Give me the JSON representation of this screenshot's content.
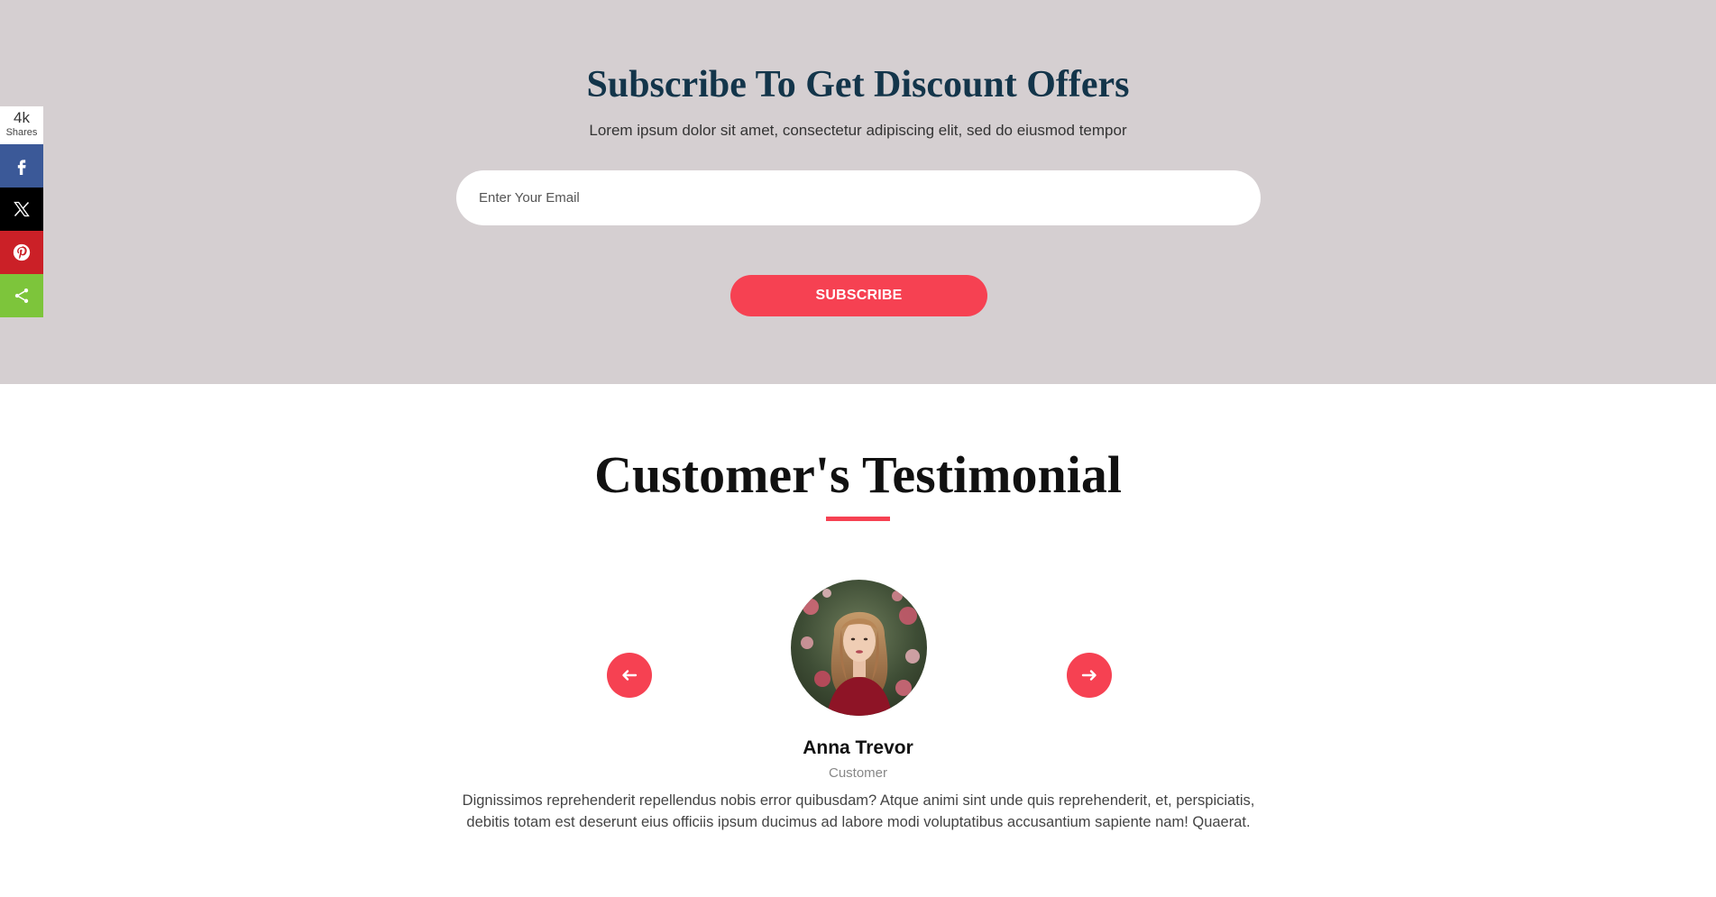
{
  "subscribe": {
    "title": "Subscribe To Get Discount Offers",
    "subtitle": "Lorem ipsum dolor sit amet, consectetur adipiscing elit, sed do eiusmod tempor",
    "email_placeholder": "Enter Your Email",
    "button_label": "SUBSCRIBE",
    "background_color": "#d5cfd1",
    "accent_color": "#f64152"
  },
  "share_bar": {
    "count": "4k",
    "count_label": "Shares",
    "buttons": [
      {
        "network": "facebook",
        "icon": "facebook-icon",
        "color": "#3b5998"
      },
      {
        "network": "x",
        "icon": "x-icon",
        "color": "#000000"
      },
      {
        "network": "pinterest",
        "icon": "pinterest-icon",
        "color": "#cb2027"
      },
      {
        "network": "share",
        "icon": "share-icon",
        "color": "#7dc53b"
      }
    ]
  },
  "testimonial": {
    "title": "Customer's Testimonial",
    "customer_name": "Anna Trevor",
    "customer_role": "Customer",
    "quote": "Dignissimos reprehenderit repellendus nobis error quibusdam? Atque animi sint unde quis reprehenderit, et, perspiciatis, debitis totam est deserunt eius officiis ipsum ducimus ad labore modi voluptatibus accusantium sapiente nam! Quaerat.",
    "prev_icon": "arrow-left-icon",
    "next_icon": "arrow-right-icon"
  }
}
